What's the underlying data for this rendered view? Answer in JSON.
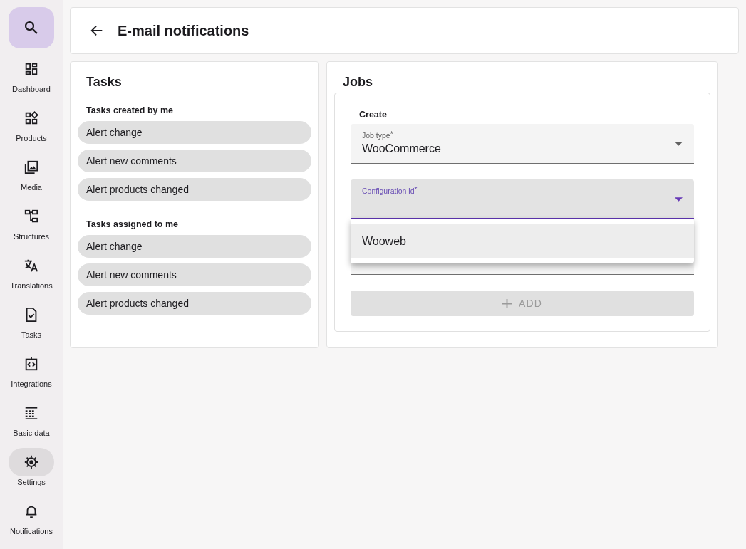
{
  "sidebar": {
    "search_button": {
      "selected": true
    },
    "items": [
      {
        "label": "Dashboard",
        "selected": false
      },
      {
        "label": "Products",
        "selected": false
      },
      {
        "label": "Media",
        "selected": false
      },
      {
        "label": "Structures",
        "selected": false
      },
      {
        "label": "Translations",
        "selected": false
      },
      {
        "label": "Tasks",
        "selected": false
      },
      {
        "label": "Integrations",
        "selected": false
      },
      {
        "label": "Basic data",
        "selected": false
      },
      {
        "label": "Settings",
        "selected": true
      },
      {
        "label": "Notifications",
        "selected": false
      }
    ]
  },
  "header": {
    "title": "E-mail notifications"
  },
  "tasks": {
    "title": "Tasks",
    "groups": [
      {
        "heading": "Tasks created by me",
        "chips": [
          "Alert change",
          "Alert new comments",
          "Alert products changed"
        ]
      },
      {
        "heading": "Tasks assigned to me",
        "chips": [
          "Alert change",
          "Alert new comments",
          "Alert products changed"
        ]
      }
    ]
  },
  "jobs": {
    "title": "Jobs",
    "section": "Create",
    "fields": [
      {
        "label": "Job type",
        "required_mark": "*",
        "value": "WooCommerce",
        "focused": false
      },
      {
        "label": "Configuration id",
        "required_mark": "*",
        "focused": true
      },
      {
        "focused": false
      }
    ],
    "menu": {
      "options": [
        {
          "label": "Wooweb",
          "highlighted": true
        }
      ]
    },
    "add_button": {
      "label": "ADD",
      "disabled": true
    }
  }
}
